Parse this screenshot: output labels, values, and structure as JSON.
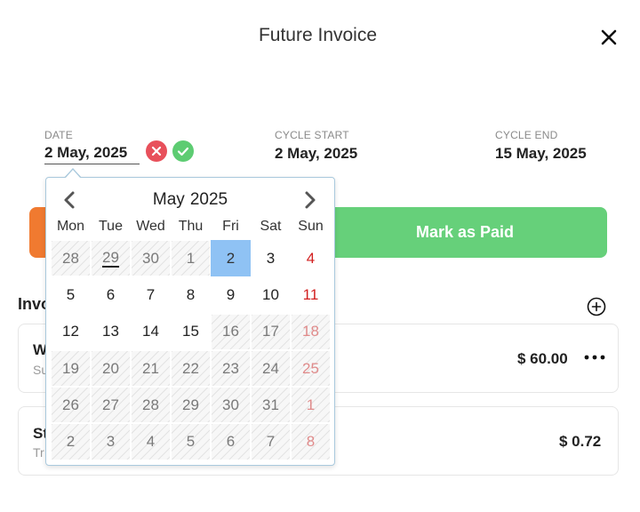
{
  "header": {
    "title": "Future Invoice"
  },
  "fields": {
    "date": {
      "label": "DATE",
      "value": "2 May, 2025"
    },
    "cycle_start": {
      "label": "CYCLE START",
      "value": "2 May, 2025"
    },
    "cycle_end": {
      "label": "CYCLE END",
      "value": "15 May, 2025"
    }
  },
  "buttons": {
    "mark_paid": "Mark as Paid"
  },
  "section": {
    "title": "Invoi"
  },
  "cards": [
    {
      "title": "W",
      "subtitle": "Su",
      "amount": "$ 60.00"
    },
    {
      "title": "St",
      "subtitle": "Tr",
      "amount": "$ 0.72"
    }
  ],
  "calendar": {
    "month": "May",
    "year": "2025",
    "weekdays": [
      "Mon",
      "Tue",
      "Wed",
      "Thu",
      "Fri",
      "Sat",
      "Sun"
    ],
    "days": [
      {
        "d": "28",
        "dis": true
      },
      {
        "d": "29",
        "dis": true,
        "today": true
      },
      {
        "d": "30",
        "dis": true
      },
      {
        "d": "1",
        "dis": true
      },
      {
        "d": "2",
        "sel": true
      },
      {
        "d": "3"
      },
      {
        "d": "4",
        "sun": true
      },
      {
        "d": "5"
      },
      {
        "d": "6"
      },
      {
        "d": "7"
      },
      {
        "d": "8"
      },
      {
        "d": "9"
      },
      {
        "d": "10"
      },
      {
        "d": "11",
        "sun": true
      },
      {
        "d": "12"
      },
      {
        "d": "13"
      },
      {
        "d": "14"
      },
      {
        "d": "15"
      },
      {
        "d": "16",
        "dis": true
      },
      {
        "d": "17",
        "dis": true
      },
      {
        "d": "18",
        "dis": true,
        "sun": true
      },
      {
        "d": "19",
        "dis": true
      },
      {
        "d": "20",
        "dis": true
      },
      {
        "d": "21",
        "dis": true
      },
      {
        "d": "22",
        "dis": true
      },
      {
        "d": "23",
        "dis": true
      },
      {
        "d": "24",
        "dis": true
      },
      {
        "d": "25",
        "dis": true,
        "sun": true
      },
      {
        "d": "26",
        "dis": true
      },
      {
        "d": "27",
        "dis": true
      },
      {
        "d": "28",
        "dis": true
      },
      {
        "d": "29",
        "dis": true
      },
      {
        "d": "30",
        "dis": true
      },
      {
        "d": "31",
        "dis": true
      },
      {
        "d": "1",
        "dis": true,
        "sun": true
      },
      {
        "d": "2",
        "dis": true
      },
      {
        "d": "3",
        "dis": true
      },
      {
        "d": "4",
        "dis": true
      },
      {
        "d": "5",
        "dis": true
      },
      {
        "d": "6",
        "dis": true
      },
      {
        "d": "7",
        "dis": true
      },
      {
        "d": "8",
        "dis": true,
        "sun": true
      }
    ]
  },
  "icons": {
    "close": "close-icon",
    "cancel": "x-circle-icon",
    "confirm": "check-circle-icon",
    "add": "plus-circle-icon",
    "more": "more-horizontal-icon",
    "prev": "chevron-left-icon",
    "next": "chevron-right-icon"
  },
  "colors": {
    "accent_green": "#66d07a",
    "accent_orange": "#f07a30",
    "danger": "#e8505b",
    "selected_day": "#8fc2f4",
    "sunday": "#d21f1f"
  }
}
